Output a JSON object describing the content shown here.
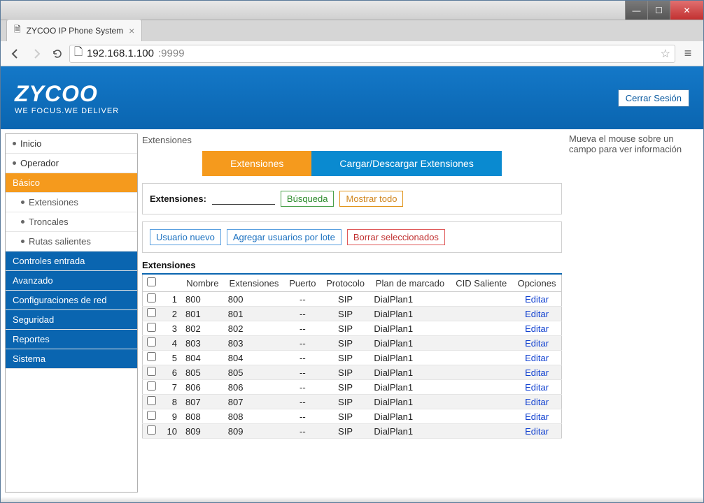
{
  "window": {
    "tab_title": "ZYCOO IP Phone System"
  },
  "browser": {
    "url_host": "192.168.1.100",
    "url_port": ":9999"
  },
  "header": {
    "logo_main": "ZYCOO",
    "logo_sub": "WE FOCUS.WE DELIVER",
    "logout": "Cerrar Sesión"
  },
  "sidebar": {
    "inicio": "Inicio",
    "operador": "Operador",
    "basico": "Básico",
    "extensiones": "Extensiones",
    "troncales": "Troncales",
    "rutas": "Rutas salientes",
    "controles": "Controles entrada",
    "avanzado": "Avanzado",
    "red": "Configuraciones de red",
    "seguridad": "Seguridad",
    "reportes": "Reportes",
    "sistema": "Sistema"
  },
  "main": {
    "breadcrumb": "Extensiones",
    "tab_ext": "Extensiones",
    "tab_load": "Cargar/Descargar Extensiones",
    "search_label": "Extensiones:",
    "search_btn": "Búsqueda",
    "show_all": "Mostrar todo",
    "new_user": "Usuario nuevo",
    "batch": "Agregar usuarios por lote",
    "delete_sel": "Borrar seleccionados",
    "table_title": "Extensiones",
    "cols": {
      "nombre": "Nombre",
      "extensiones": "Extensiones",
      "puerto": "Puerto",
      "protocolo": "Protocolo",
      "plan": "Plan de marcado",
      "cid": "CID Saliente",
      "opciones": "Opciones"
    },
    "edit": "Editar",
    "rows": [
      {
        "n": "1",
        "nombre": "800",
        "ext": "800",
        "puerto": "--",
        "proto": "SIP",
        "plan": "DialPlan1",
        "cid": ""
      },
      {
        "n": "2",
        "nombre": "801",
        "ext": "801",
        "puerto": "--",
        "proto": "SIP",
        "plan": "DialPlan1",
        "cid": ""
      },
      {
        "n": "3",
        "nombre": "802",
        "ext": "802",
        "puerto": "--",
        "proto": "SIP",
        "plan": "DialPlan1",
        "cid": ""
      },
      {
        "n": "4",
        "nombre": "803",
        "ext": "803",
        "puerto": "--",
        "proto": "SIP",
        "plan": "DialPlan1",
        "cid": ""
      },
      {
        "n": "5",
        "nombre": "804",
        "ext": "804",
        "puerto": "--",
        "proto": "SIP",
        "plan": "DialPlan1",
        "cid": ""
      },
      {
        "n": "6",
        "nombre": "805",
        "ext": "805",
        "puerto": "--",
        "proto": "SIP",
        "plan": "DialPlan1",
        "cid": ""
      },
      {
        "n": "7",
        "nombre": "806",
        "ext": "806",
        "puerto": "--",
        "proto": "SIP",
        "plan": "DialPlan1",
        "cid": ""
      },
      {
        "n": "8",
        "nombre": "807",
        "ext": "807",
        "puerto": "--",
        "proto": "SIP",
        "plan": "DialPlan1",
        "cid": ""
      },
      {
        "n": "9",
        "nombre": "808",
        "ext": "808",
        "puerto": "--",
        "proto": "SIP",
        "plan": "DialPlan1",
        "cid": ""
      },
      {
        "n": "10",
        "nombre": "809",
        "ext": "809",
        "puerto": "--",
        "proto": "SIP",
        "plan": "DialPlan1",
        "cid": ""
      }
    ]
  },
  "help": {
    "text": "Mueva el mouse sobre un campo para ver información"
  }
}
